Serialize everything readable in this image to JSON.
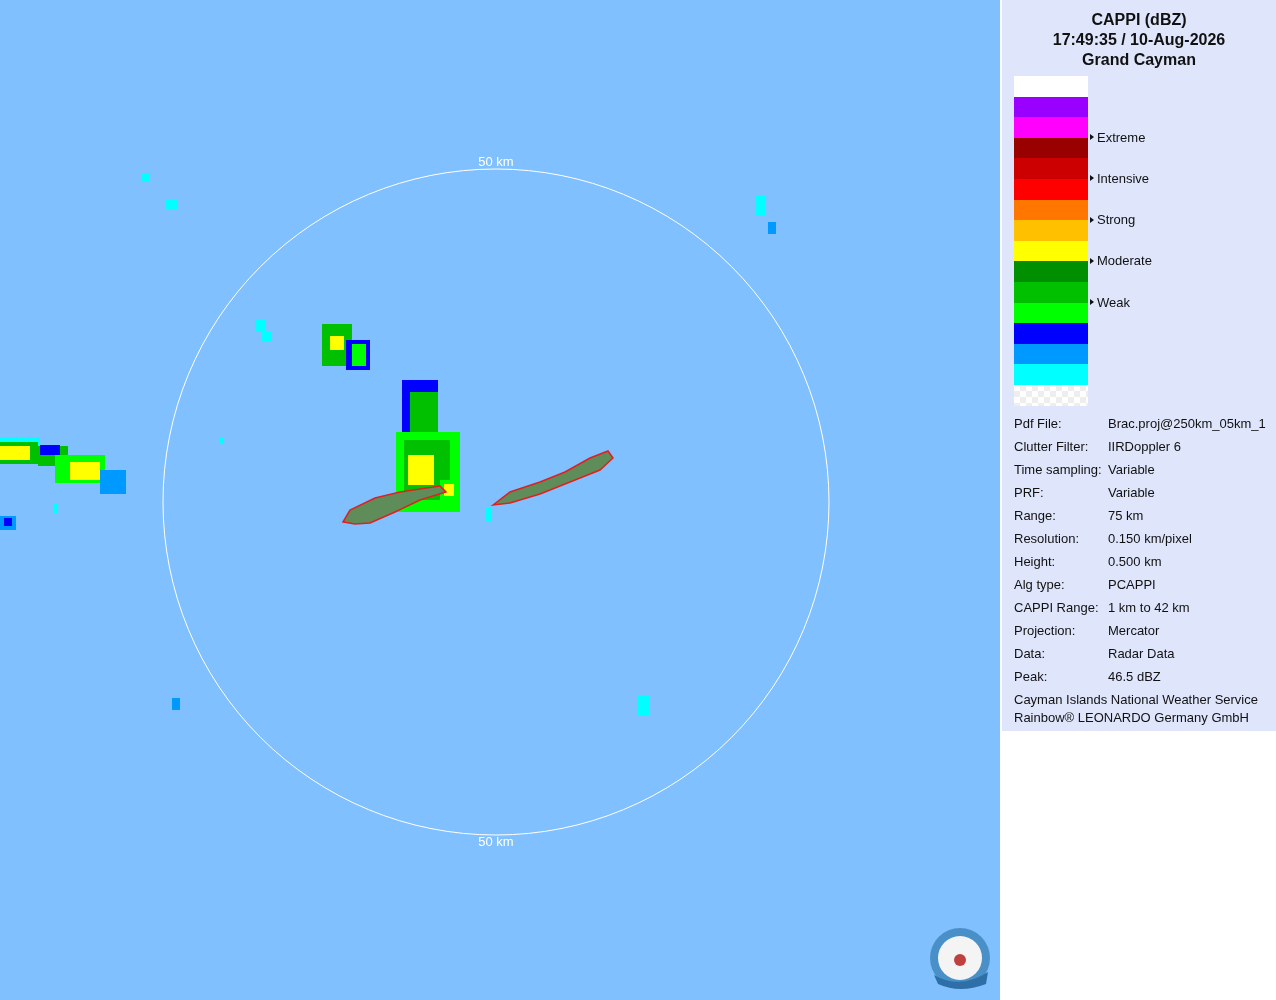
{
  "map": {
    "range_labels": [
      "50 km",
      "50 km"
    ]
  },
  "legend": {
    "title": "CAPPI (dBZ)",
    "time": "17:49:35 / 10-Aug-2026",
    "site": "Grand Cayman",
    "bands": [
      {
        "kind": "solid",
        "color": "#ffffff"
      },
      {
        "kind": "solid",
        "color": "#9900ff"
      },
      {
        "kind": "solid",
        "color": "#ff00ff"
      },
      {
        "kind": "solid",
        "color": "#990000",
        "label": "Extreme"
      },
      {
        "kind": "solid",
        "color": "#cc0000"
      },
      {
        "kind": "solid",
        "color": "#ff0000",
        "label": "Intensive"
      },
      {
        "kind": "solid",
        "color": "#ff7700"
      },
      {
        "kind": "solid",
        "color": "#ffc000",
        "label": "Strong"
      },
      {
        "kind": "solid",
        "color": "#ffff00"
      },
      {
        "kind": "solid",
        "color": "#008f00",
        "label": "Moderate"
      },
      {
        "kind": "solid",
        "color": "#00c000"
      },
      {
        "kind": "solid",
        "color": "#00ff00",
        "label": "Weak"
      },
      {
        "kind": "solid",
        "color": "#0000ff"
      },
      {
        "kind": "solid",
        "color": "#0099ff"
      },
      {
        "kind": "solid",
        "color": "#00ffff"
      },
      {
        "kind": "checkered"
      }
    ]
  },
  "info": [
    {
      "label": "Pdf File:",
      "value": "Brac.proj@250km_05km_1"
    },
    {
      "label": "Clutter Filter:",
      "value": "IIRDoppler 6"
    },
    {
      "label": "Time sampling:",
      "value": "Variable"
    },
    {
      "label": "PRF:",
      "value": "Variable"
    },
    {
      "label": "Range:",
      "value": "75 km"
    },
    {
      "label": "Resolution:",
      "value": "0.150 km/pixel"
    },
    {
      "label": "Height:",
      "value": "0.500 km"
    },
    {
      "label": "Alg type:",
      "value": "PCAPPI"
    },
    {
      "label": "CAPPI Range:",
      "value": "1 km to 42 km"
    },
    {
      "label": "Projection:",
      "value": "Mercator"
    },
    {
      "label": "Data:",
      "value": "Radar Data"
    },
    {
      "label": "Peak:",
      "value": "46.5 dBZ"
    }
  ],
  "credits": [
    "Cayman Islands National Weather Service",
    "Rainbow® LEONARDO Germany GmbH"
  ]
}
